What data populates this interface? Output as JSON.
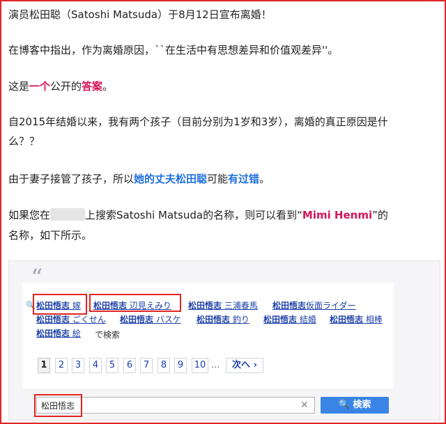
{
  "article": {
    "p1": "演员松田聪（Satoshi Matsuda）于8月12日宣布离婚！",
    "p2": "在博客中指出，作为离婚原因，``在生活中有思想差异和价值观差异''。",
    "p3": {
      "pre": "这是",
      "em1": "一个",
      "mid": "公开的",
      "em2": "答案",
      "post": "。"
    },
    "p4a": "自2015年结婚以来，我有两个孩子（目前分别为1岁和3岁），离婚的真正原因是什",
    "p4b": "么？？",
    "p5": {
      "pre": "由于妻子接管了孩子，所以",
      "em1": "她的丈夫松田聪",
      "mid": "可能",
      "em2": "有过错",
      "post": "。"
    },
    "p6a": {
      "pre": "如果您在",
      "post": "上搜索Satoshi Matsuda的名称，则可以看到“",
      "em": "Mimi Henmi",
      "end": "”的"
    },
    "p6b": "名称，如下所示。"
  },
  "screenshot": {
    "quote_mark": "“",
    "suggestions": [
      {
        "bold": "松田悟志",
        "rest": " 嫁"
      },
      {
        "bold": "松田悟志",
        "rest": " 辺見えみり"
      },
      {
        "bold": "松田悟志",
        "rest": " 三浦春馬"
      },
      {
        "bold": "松田悟志",
        "rest": "仮面ライダー"
      },
      {
        "bold": "松田悟志",
        "rest": " ごくせん"
      },
      {
        "bold": "松田悟志",
        "rest": " バスケ"
      },
      {
        "bold": "松田悟志",
        "rest": " 釣り"
      },
      {
        "bold": "松田悟志",
        "rest": " 結婚"
      },
      {
        "bold": "松田悟志",
        "rest": " 相棒"
      },
      {
        "bold": "松田悟志",
        "rest": " 絵"
      }
    ],
    "search_suffix": "で検索",
    "pages": [
      "1",
      "2",
      "3",
      "4",
      "5",
      "6",
      "7",
      "8",
      "9",
      "10"
    ],
    "current_page": "1",
    "ellipsis": "...",
    "next_label": "次へ ›",
    "search_value": "松田悟志",
    "clear_glyph": "✕",
    "search_button": "🔍 検索"
  },
  "colors": {
    "frame": "#e02424",
    "emphasis_red": "#d4145a",
    "emphasis_blue": "#1e6fe0",
    "search_button": "#3a84e6",
    "link": "#1c3fa8"
  }
}
